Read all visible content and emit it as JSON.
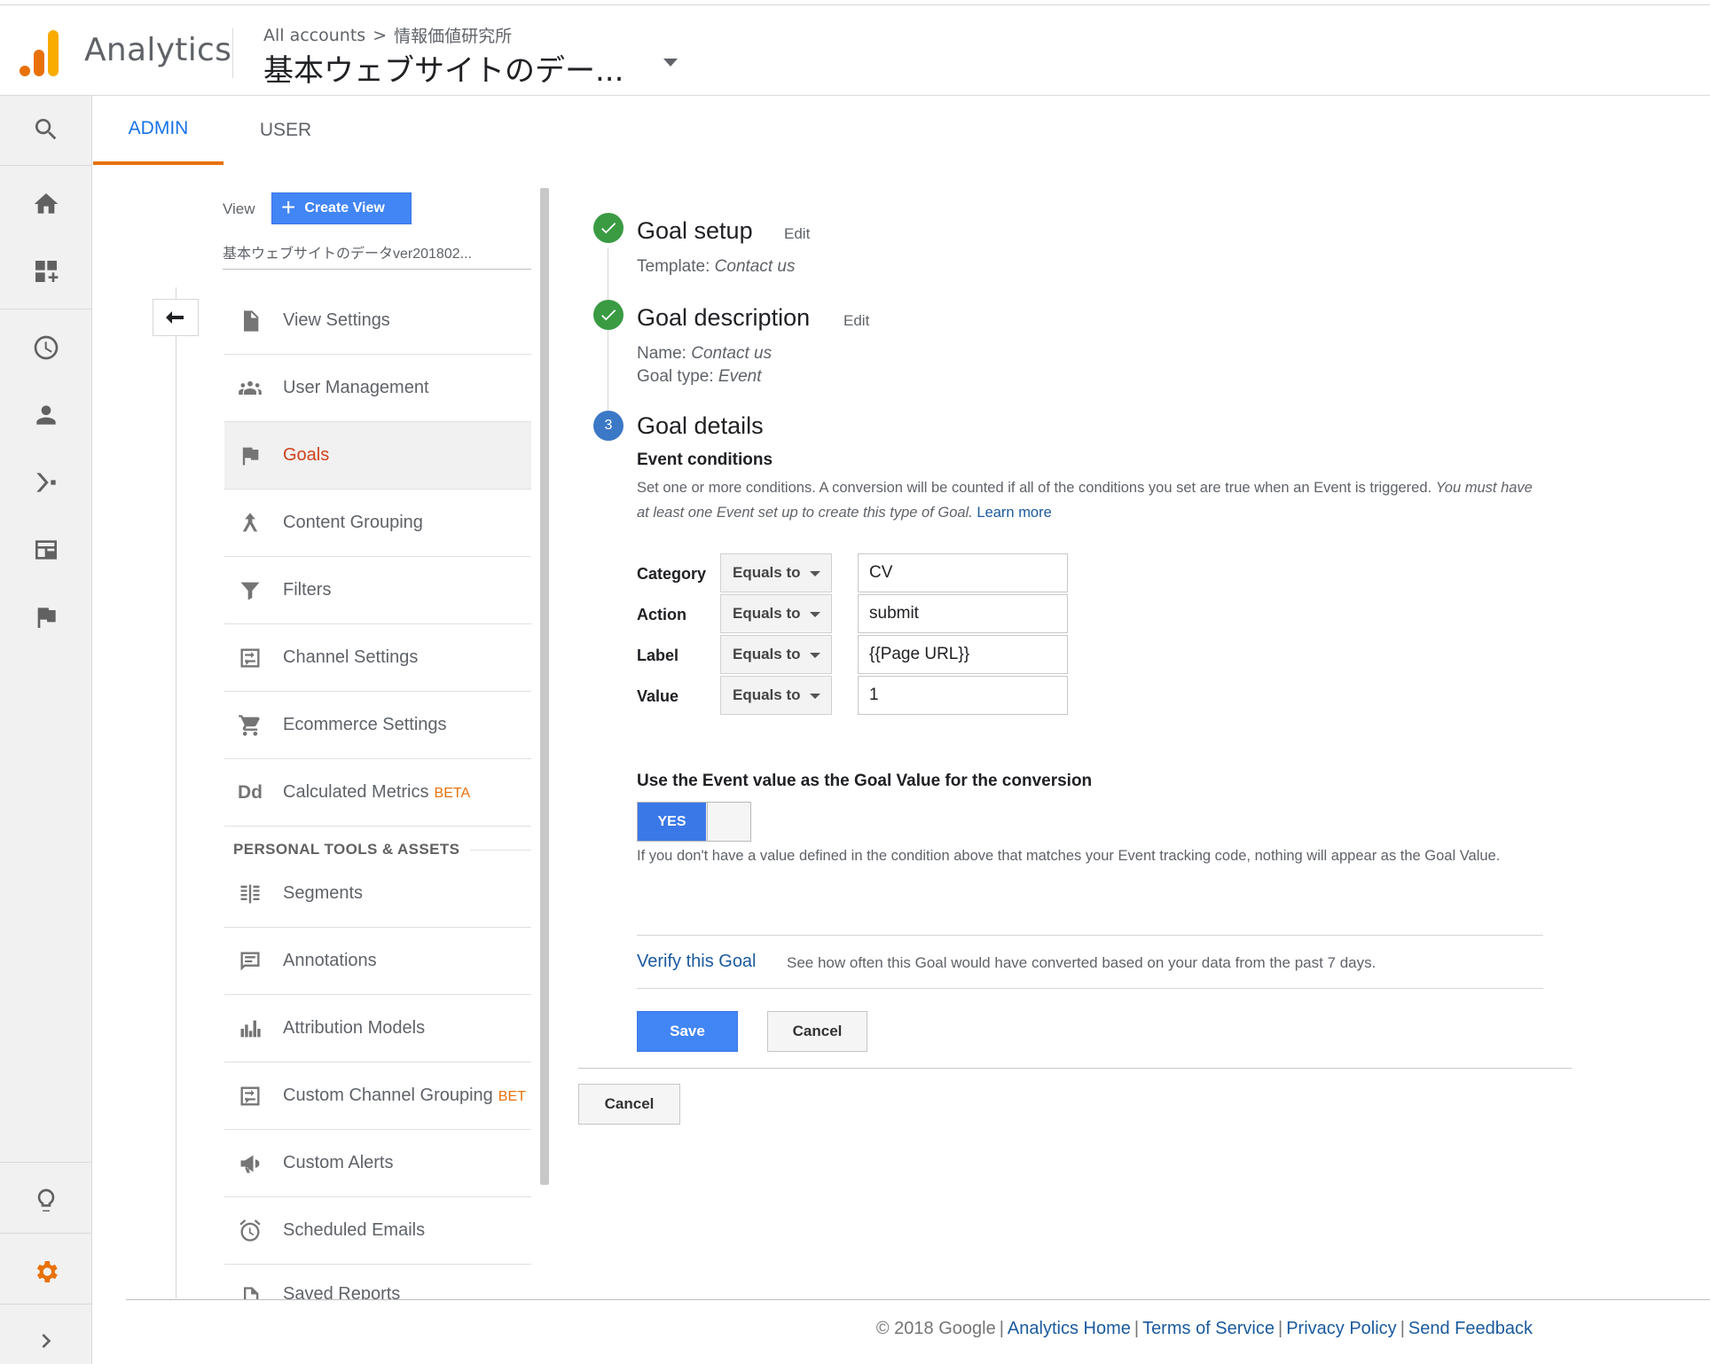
{
  "header": {
    "app_name": "Analytics",
    "breadcrumb_root": "All accounts",
    "breadcrumb_sep": ">",
    "breadcrumb_property": "情報価値研究所",
    "view_name": "基本ウェブサイトのデー..."
  },
  "rail": {
    "icons": [
      "search-icon",
      "home-icon",
      "customization-icon",
      "realtime-icon",
      "audience-icon",
      "acquisition-icon",
      "behavior-icon",
      "conversions-icon",
      "discover-icon",
      "admin-gear-icon",
      "expand-icon"
    ]
  },
  "tabs": {
    "admin": "ADMIN",
    "user": "USER"
  },
  "view_column": {
    "view_label": "View",
    "create_view_plus": "+",
    "create_view": "Create View",
    "view_select": "基本ウェブサイトのデータver201802..."
  },
  "nav": {
    "items": [
      {
        "label": "View Settings"
      },
      {
        "label": "User Management"
      },
      {
        "label": "Goals"
      },
      {
        "label": "Content Grouping"
      },
      {
        "label": "Filters"
      },
      {
        "label": "Channel Settings"
      },
      {
        "label": "Ecommerce Settings"
      },
      {
        "label": "Calculated Metrics",
        "badge": "BETA"
      },
      {
        "label": "Segments"
      },
      {
        "label": "Annotations"
      },
      {
        "label": "Attribution Models"
      },
      {
        "label": "Custom Channel Grouping",
        "badge": "BET"
      },
      {
        "label": "Custom Alerts"
      },
      {
        "label": "Scheduled Emails"
      },
      {
        "label": "Saved Reports"
      }
    ],
    "section_personal": "PERSONAL TOOLS & ASSETS",
    "calc_metrics_icon_text": "Dd"
  },
  "goal": {
    "setup_title": "Goal setup",
    "setup_edit": "Edit",
    "template_label": "Template:",
    "template_value": "Contact us",
    "desc_title": "Goal description",
    "desc_edit": "Edit",
    "name_label": "Name:",
    "name_value": "Contact us",
    "type_label": "Goal type:",
    "type_value": "Event",
    "details_step": "3",
    "details_title": "Goal details",
    "event_conditions_title": "Event conditions",
    "event_conditions_desc": "Set one or more conditions. A conversion will be counted if all of the conditions you set are true when an Event is triggered.",
    "event_conditions_note": "You must have at least one Event set up to create this type of Goal.",
    "learn_more": "Learn more",
    "conditions": [
      {
        "label": "Category",
        "operator": "Equals to",
        "value": "CV"
      },
      {
        "label": "Action",
        "operator": "Equals to",
        "value": "submit"
      },
      {
        "label": "Label",
        "operator": "Equals to",
        "value": "{{Page URL}}"
      },
      {
        "label": "Value",
        "operator": "Equals to",
        "value": "1"
      }
    ],
    "use_value_title": "Use the Event value as the Goal Value for the conversion",
    "toggle_label": "YES",
    "toggle_on": true,
    "hint": "If you don't have a value defined in the condition above that matches your Event tracking code, nothing will appear as the Goal Value.",
    "verify_link": "Verify this Goal",
    "verify_desc": "See how often this Goal would have converted based on your data from the past 7 days.",
    "save": "Save",
    "cancel_inner": "Cancel",
    "cancel_outer": "Cancel"
  },
  "footer": {
    "copyright": "© 2018 Google",
    "links": [
      "Analytics Home",
      "Terms of Service",
      "Privacy Policy",
      "Send Feedback"
    ]
  },
  "colors": {
    "accent_blue": "#4285f4",
    "active_red": "#d0421b",
    "tab_underline": "#e8710a",
    "check_green": "#3a9b43",
    "link_blue": "#1a5a9e"
  }
}
